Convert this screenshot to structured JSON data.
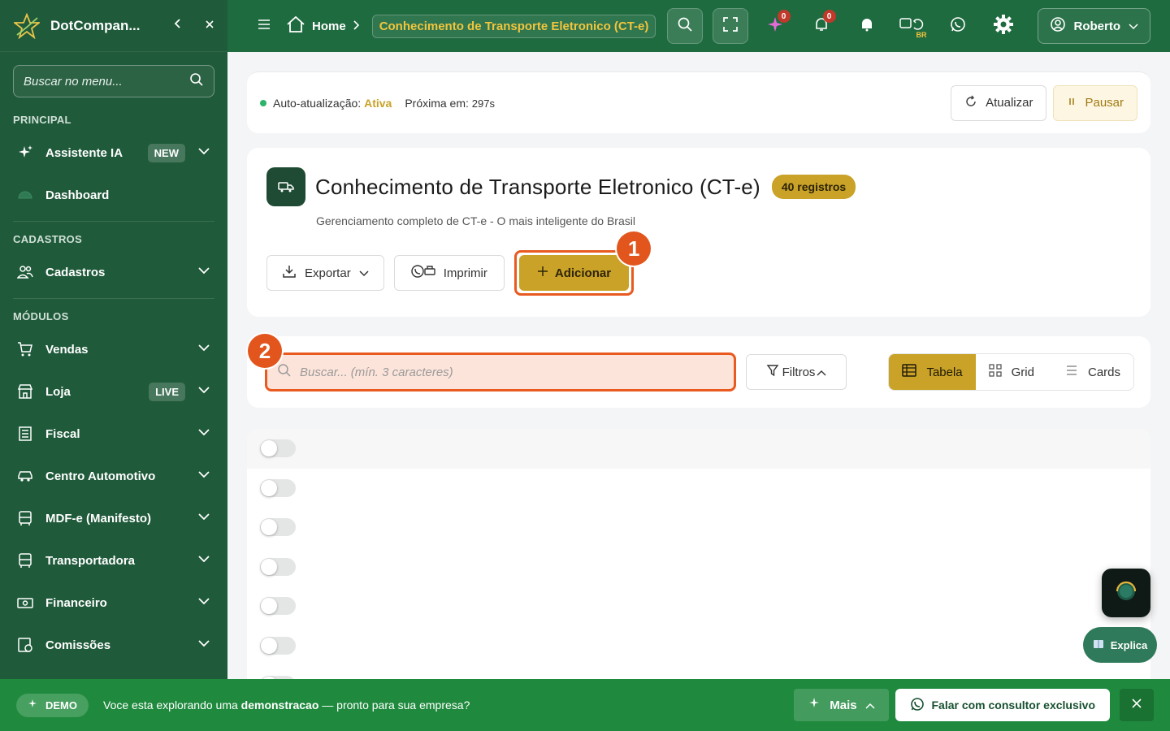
{
  "sidebar": {
    "brand": "DotCompan...",
    "search_placeholder": "Buscar no menu...",
    "sections": {
      "principal": "PRINCIPAL",
      "cadastros": "CADASTROS",
      "modulos": "MÓDULOS"
    },
    "items": {
      "assistente": {
        "label": "Assistente IA",
        "badge": "NEW"
      },
      "dashboard": {
        "label": "Dashboard"
      },
      "cadastros": {
        "label": "Cadastros"
      },
      "vendas": {
        "label": "Vendas"
      },
      "loja": {
        "label": "Loja",
        "badge": "LIVE"
      },
      "fiscal": {
        "label": "Fiscal"
      },
      "automotivo": {
        "label": "Centro Automotivo"
      },
      "mdfe": {
        "label": "MDF-e (Manifesto)"
      },
      "transportadora": {
        "label": "Transportadora"
      },
      "financeiro": {
        "label": "Financeiro"
      },
      "comissoes": {
        "label": "Comissões"
      }
    }
  },
  "topbar": {
    "home": "Home",
    "current": "Conhecimento de Transporte Eletronico (CT-e)",
    "ai_count": "0",
    "notif_count": "0",
    "lang": "BR",
    "user": "Roberto"
  },
  "status": {
    "label": "Auto-atualização:",
    "value": "Ativa",
    "next_label": "Próxima em:",
    "next_value": "297s",
    "refresh": "Atualizar",
    "pause": "Pausar"
  },
  "page": {
    "title": "Conhecimento de Transporte Eletronico (CT-e)",
    "count": "40 registros",
    "subtitle": "Gerenciamento completo de CT-e - O mais inteligente do Brasil",
    "export": "Exportar",
    "print": "Imprimir",
    "add": "Adicionar"
  },
  "markers": {
    "one": "1",
    "two": "2"
  },
  "filters": {
    "search_placeholder": "Buscar... (mín. 3 caracteres)",
    "filters": "Filtros",
    "views": {
      "table": "Tabela",
      "grid": "Grid",
      "cards": "Cards"
    }
  },
  "floating": {
    "explica": "Explica"
  },
  "demo": {
    "pill": "DEMO",
    "text_a": "Voce esta explorando uma ",
    "text_b": "demonstracao",
    "text_c": " — pronto para sua empresa?",
    "more": "Mais",
    "consult": "Falar com consultor exclusivo"
  },
  "colors": {
    "sidebar": "#1f5a3a",
    "topbar": "#1f6b40",
    "gold": "#c9a227",
    "highlight": "#e85a1f",
    "demo_bar": "#1f8a3e"
  }
}
